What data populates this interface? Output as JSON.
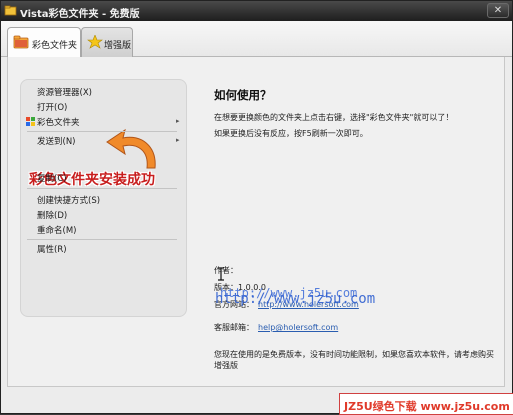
{
  "window": {
    "title": "Vista彩色文件夹 - 免费版",
    "close_glyph": "✕"
  },
  "tabs": [
    {
      "label": "彩色文件夹",
      "icon": "folder-icon",
      "active": true
    },
    {
      "label": "增强版",
      "icon": "star-icon",
      "active": false
    }
  ],
  "context_menu": {
    "items": [
      {
        "label": "资源管理器(X)"
      },
      {
        "label": "打开(O)"
      },
      {
        "label": "彩色文件夹",
        "has_submenu": true,
        "icon": "colorful-folder-icon"
      },
      {
        "label": "发送到(N)",
        "has_submenu": true
      },
      {
        "label": "复制(C)"
      },
      {
        "label": "创建快捷方式(S)"
      },
      {
        "label": "删除(D)"
      },
      {
        "label": "重命名(M)"
      },
      {
        "label": "属性(R)"
      }
    ],
    "submenu_arrow": "▸"
  },
  "banner": {
    "text": "彩色文件夹安装成功",
    "color": "#c81e1e"
  },
  "help": {
    "heading": "如何使用？",
    "line1": "在想要更换颜色的文件夹上点击右键，选择\"彩色文件夹\"就可以了！",
    "line2": "如果更换后没有反应，按F5刷新一次即可。"
  },
  "info": {
    "author_label": "作者：",
    "version_label": "版本：",
    "version_value": "1.0.0.0",
    "website_label": "官方网站：",
    "website_value": "http://www.holersoft.com",
    "email_label": "客服邮箱：",
    "email_value": "help@holersoft.com"
  },
  "footer_note": "您现在使用的是免费版本，没有时间功能限制，如果您喜欢本软件，请考虑购买增强版",
  "watermarks": {
    "a": "http://www.jz5u.com",
    "b": "http://www.jz5u.com"
  },
  "brand": {
    "text": "JZ5U绿色下载 www.jz5u.com"
  }
}
